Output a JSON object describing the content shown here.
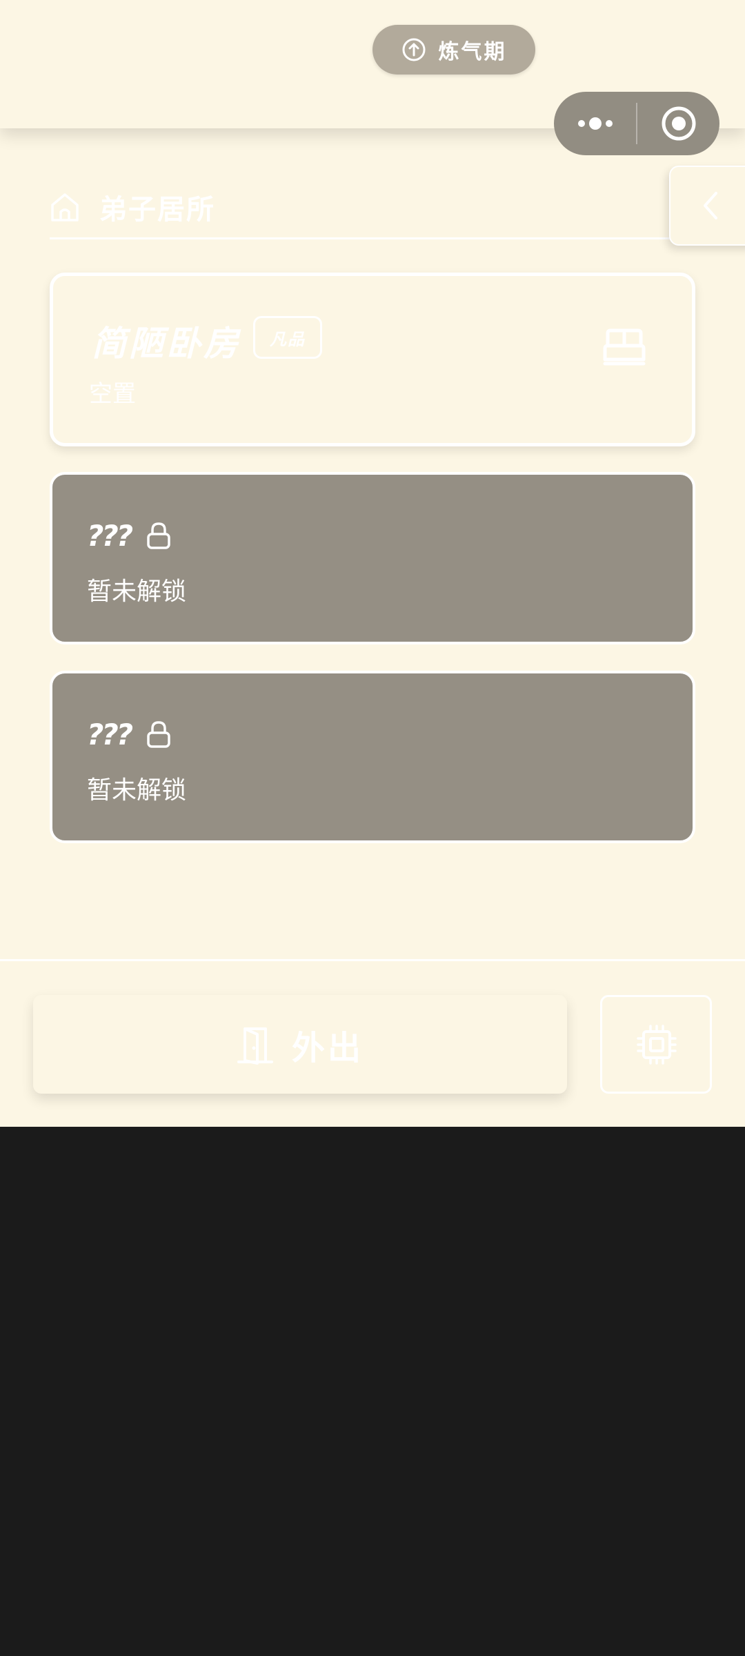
{
  "header": {
    "realm_label": "炼气期",
    "realm_icon": "arrow-up-circle-icon",
    "breadcrumb_label": "弟子居所",
    "breadcrumb_icon": "home-icon",
    "back_icon": "chevron-left-icon"
  },
  "rooms": [
    {
      "name": "简陋卧房",
      "grade": "凡品",
      "status": "空置",
      "icon": "bed-icon",
      "unlocked": true
    },
    {
      "name": "???",
      "status": "暂未解锁",
      "icon": "lock-icon",
      "unlocked": false
    },
    {
      "name": "???",
      "status": "暂未解锁",
      "icon": "lock-icon",
      "unlocked": false
    }
  ],
  "footer": {
    "exit_label": "外出",
    "exit_icon": "door-icon",
    "chip_icon": "chip-icon"
  },
  "colors": {
    "background": "#fcf6e4",
    "locked_card": "#958f84",
    "pill": "#b2aa9b",
    "capsule": "#928d82",
    "outside": "#1b1b1b"
  }
}
